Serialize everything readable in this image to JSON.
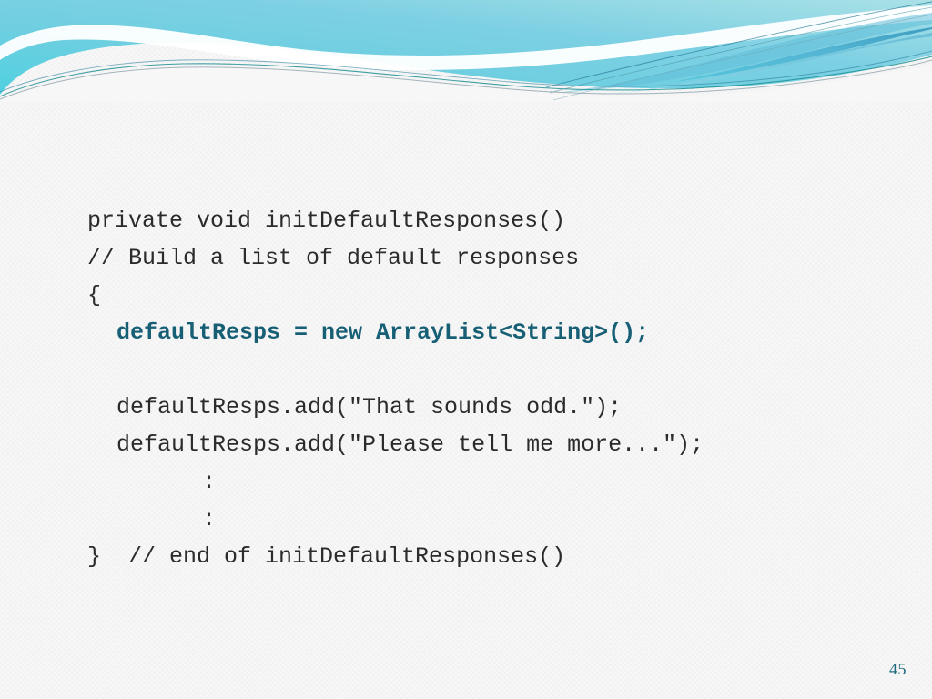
{
  "slide": {
    "background_color": "#f7f7f7",
    "page_number": "45"
  },
  "banner": {
    "name": "decorative-wave-banner",
    "colors": {
      "cyan_left": "#5fd3e2",
      "cyan_mid": "#72cfe0",
      "blue_right": "#8fd2e5",
      "teal_light": "#a9e0e4",
      "swoosh_blue": "#5bb8d4",
      "swoosh_blue_dark": "#3e9cc0",
      "hairline_teal": "#1f7f86",
      "hairline_gray": "#8fa3ad",
      "white": "#ffffff"
    }
  },
  "code": {
    "language": "java",
    "accent_color": "#165f75",
    "text_color": "#2b2b2b",
    "lines": [
      {
        "text": "private void initDefaultResponses()",
        "indent": 0,
        "highlight": false
      },
      {
        "text": "// Build a list of default responses",
        "indent": 0,
        "highlight": false
      },
      {
        "text": "{",
        "indent": 0,
        "highlight": false
      },
      {
        "text": "defaultResps = new ArrayList<String>();",
        "indent": 1,
        "highlight": true
      },
      {
        "text": "",
        "indent": 0,
        "highlight": false
      },
      {
        "text": "defaultResps.add(\"That sounds odd.\");",
        "indent": 1,
        "highlight": false
      },
      {
        "text": "defaultResps.add(\"Please tell me more...\");",
        "indent": 1,
        "highlight": false
      },
      {
        "text": ":",
        "indent": 2,
        "highlight": false
      },
      {
        "text": ":",
        "indent": 2,
        "highlight": false
      },
      {
        "text": "}  // end of initDefaultResponses()",
        "indent": 0,
        "highlight": false
      }
    ]
  }
}
